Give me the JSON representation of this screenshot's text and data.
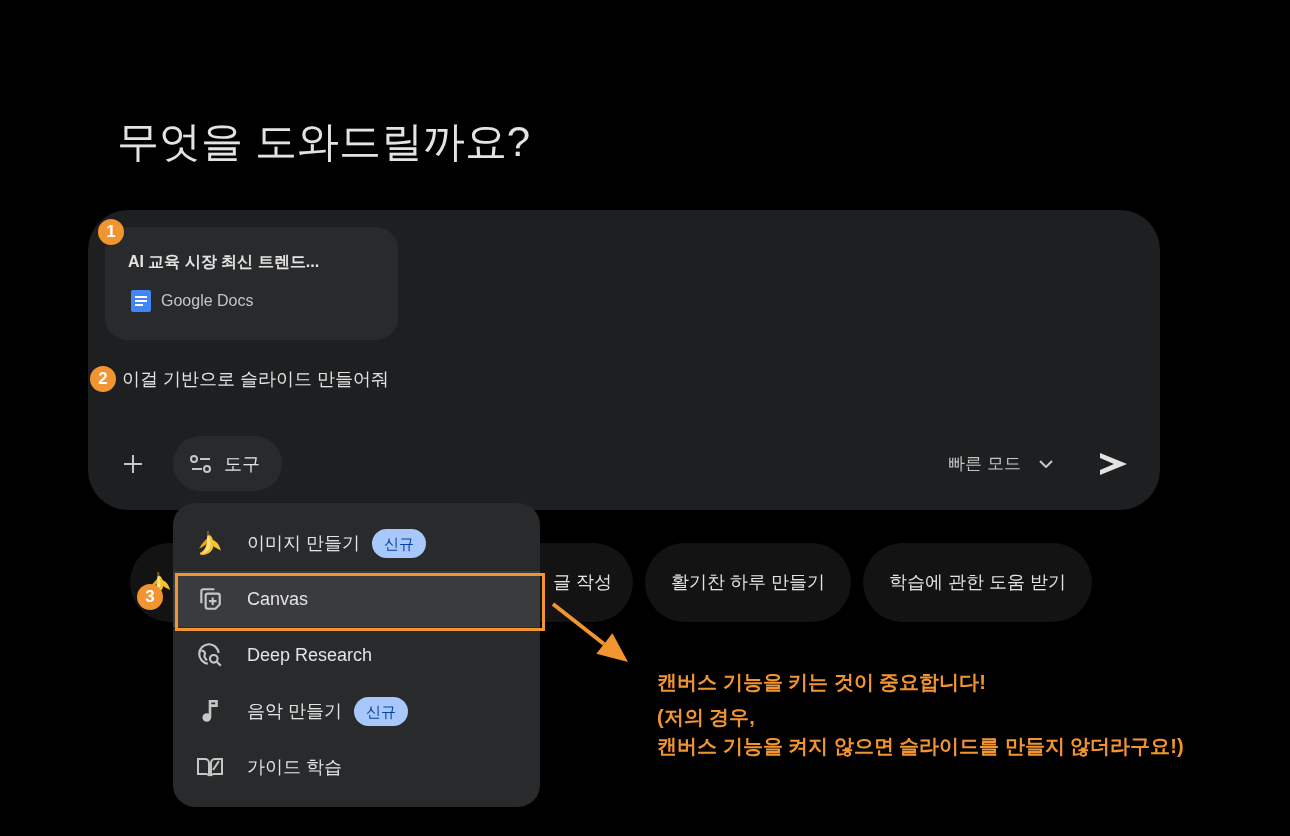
{
  "heading": "무엇을 도와드릴까요?",
  "composer": {
    "attachment": {
      "title": "AI 교육 시장 최신 트렌드...",
      "source": "Google Docs"
    },
    "prompt": "이걸 기반으로 슬라이드 만들어줘",
    "tools_button": "도구",
    "mode_selector": "빠른 모드"
  },
  "tools_menu": {
    "items": [
      {
        "label": "이미지 만들기",
        "badge": "신규",
        "selected": false
      },
      {
        "label": "Canvas",
        "selected": true
      },
      {
        "label": "Deep Research",
        "selected": false
      },
      {
        "label": "음악 만들기",
        "badge": "신규",
        "selected": false
      },
      {
        "label": "가이드 학습",
        "selected": false
      }
    ]
  },
  "suggestions": [
    {
      "kind": "emoji"
    },
    {
      "kind": "text",
      "label": "글 작성"
    },
    {
      "kind": "text",
      "label": "활기찬 하루 만들기"
    },
    {
      "kind": "text",
      "label": "학습에 관한 도움 받기"
    }
  ],
  "annotations": {
    "markers": [
      "1",
      "2",
      "3"
    ],
    "note": [
      "캔버스 기능을 키는 것이 중요합니다!",
      "(저의 경우,",
      "캔버스 기능을 켜지 않으면 슬라이드를 만들지 않더라구요!)"
    ]
  }
}
